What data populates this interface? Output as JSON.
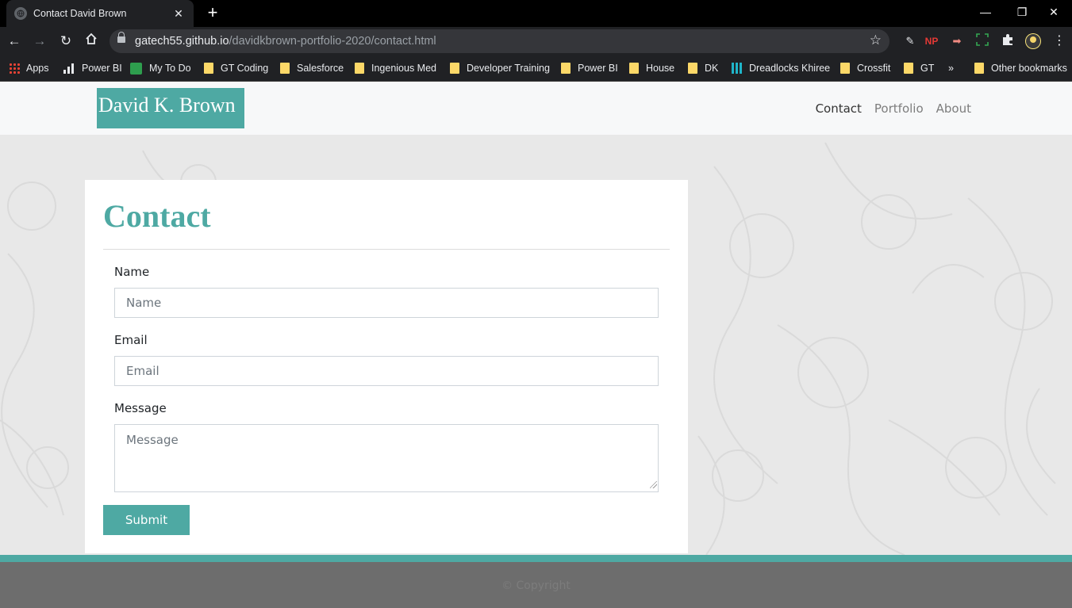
{
  "browser": {
    "tab_title": "Contact David Brown",
    "url_host": "gatech55.github.io",
    "url_path": "/davidkbrown-portfolio-2020/contact.html",
    "extensions": [
      "pen-icon",
      "NP",
      "arrow-extension-icon",
      "screenshot-extension-icon",
      "puzzle-icon",
      "profile-avatar"
    ],
    "bookmarks": [
      {
        "label": "Apps",
        "icon": "apps-grid-icon"
      },
      {
        "label": "Power BI",
        "icon": "bar-chart-icon"
      },
      {
        "label": "My To Do",
        "icon": "todo-icon"
      },
      {
        "label": "GT Coding",
        "icon": "folder-icon"
      },
      {
        "label": "Salesforce",
        "icon": "folder-icon"
      },
      {
        "label": "Ingenious Med",
        "icon": "folder-icon"
      },
      {
        "label": "Developer Training",
        "icon": "folder-icon"
      },
      {
        "label": "Power BI",
        "icon": "folder-icon"
      },
      {
        "label": "House",
        "icon": "folder-icon"
      },
      {
        "label": "DK",
        "icon": "folder-icon"
      },
      {
        "label": "Dreadlocks Khiree",
        "icon": "grid-icon"
      },
      {
        "label": "Crossfit",
        "icon": "folder-icon"
      },
      {
        "label": "GT",
        "icon": "folder-icon"
      },
      {
        "label": "»",
        "icon": "overflow-chevron"
      },
      {
        "label": "Other bookmarks",
        "icon": "folder-icon"
      }
    ]
  },
  "site": {
    "brand": "David K. Brown",
    "nav": [
      "Contact",
      "Portfolio",
      "About"
    ],
    "active_nav": "Contact",
    "accent_color": "#4ea9a3"
  },
  "form": {
    "title": "Contact",
    "name_label": "Name",
    "name_placeholder": "Name",
    "email_label": "Email",
    "email_placeholder": "Email",
    "message_label": "Message",
    "message_placeholder": "Message",
    "submit_label": "Submit"
  },
  "footer": {
    "copyright": "© Copyright"
  }
}
